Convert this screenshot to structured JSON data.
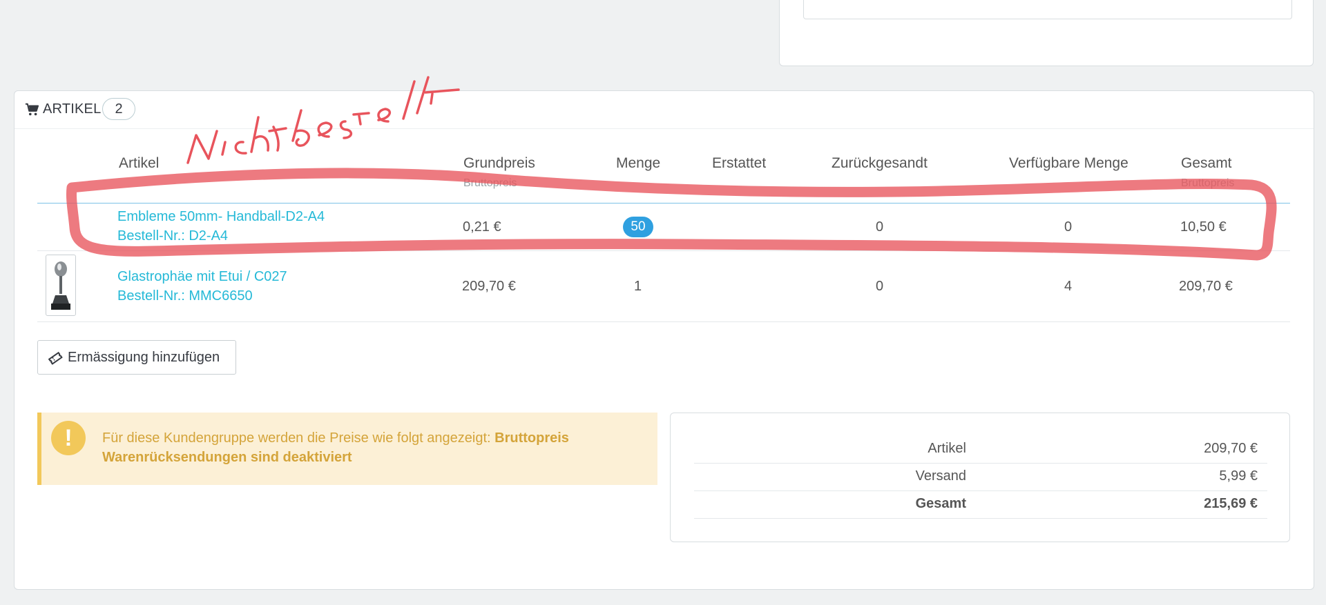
{
  "panel": {
    "title": "ARTIKEL",
    "count": "2"
  },
  "table": {
    "headers": {
      "artikel": "Artikel",
      "grundpreis": "Grundpreis",
      "grundpreis_sub": "Bruttopreis",
      "menge": "Menge",
      "erstattet": "Erstattet",
      "zurueckgesandt": "Zurückgesandt",
      "verfuegbar": "Verfügbare Menge",
      "gesamt": "Gesamt",
      "gesamt_sub": "Bruttopreis"
    },
    "rows": [
      {
        "name": "Embleme 50mm- Handball-D2-A4",
        "ref": "Bestell-Nr.: D2-A4",
        "price": "0,21 €",
        "qty": "50",
        "refunded": "",
        "returned": "0",
        "available": "0",
        "total": "10,50 €"
      },
      {
        "name": "Glastrophäe mit Etui / C027",
        "ref": "Bestell-Nr.: MMC6650",
        "price": "209,70 €",
        "qty": "1",
        "refunded": "",
        "returned": "0",
        "available": "4",
        "total": "209,70 €"
      }
    ]
  },
  "discount_button": "Ermässigung hinzufügen",
  "alert": {
    "line1_text": "Für diese Kundengruppe werden die Preise wie folgt angezeigt: ",
    "line1_bold": "Bruttopreis",
    "line2": "Warenrücksendungen sind deaktiviert"
  },
  "totals": [
    {
      "label": "Artikel",
      "value": "209,70 €"
    },
    {
      "label": "Versand",
      "value": "5,99 €"
    },
    {
      "label": "Gesamt",
      "value": "215,69 €"
    }
  ],
  "annotation": "Nicht bestellt",
  "colors": {
    "link": "#25b9d7",
    "badge": "#2fa0e0",
    "alert_bg": "#fcf0d6",
    "alert_text": "#d4a43a",
    "annotation": "#e8545c"
  },
  "icons": {
    "cart": "shopping-cart-icon",
    "discount": "ticket-icon",
    "alert": "exclamation-icon"
  }
}
